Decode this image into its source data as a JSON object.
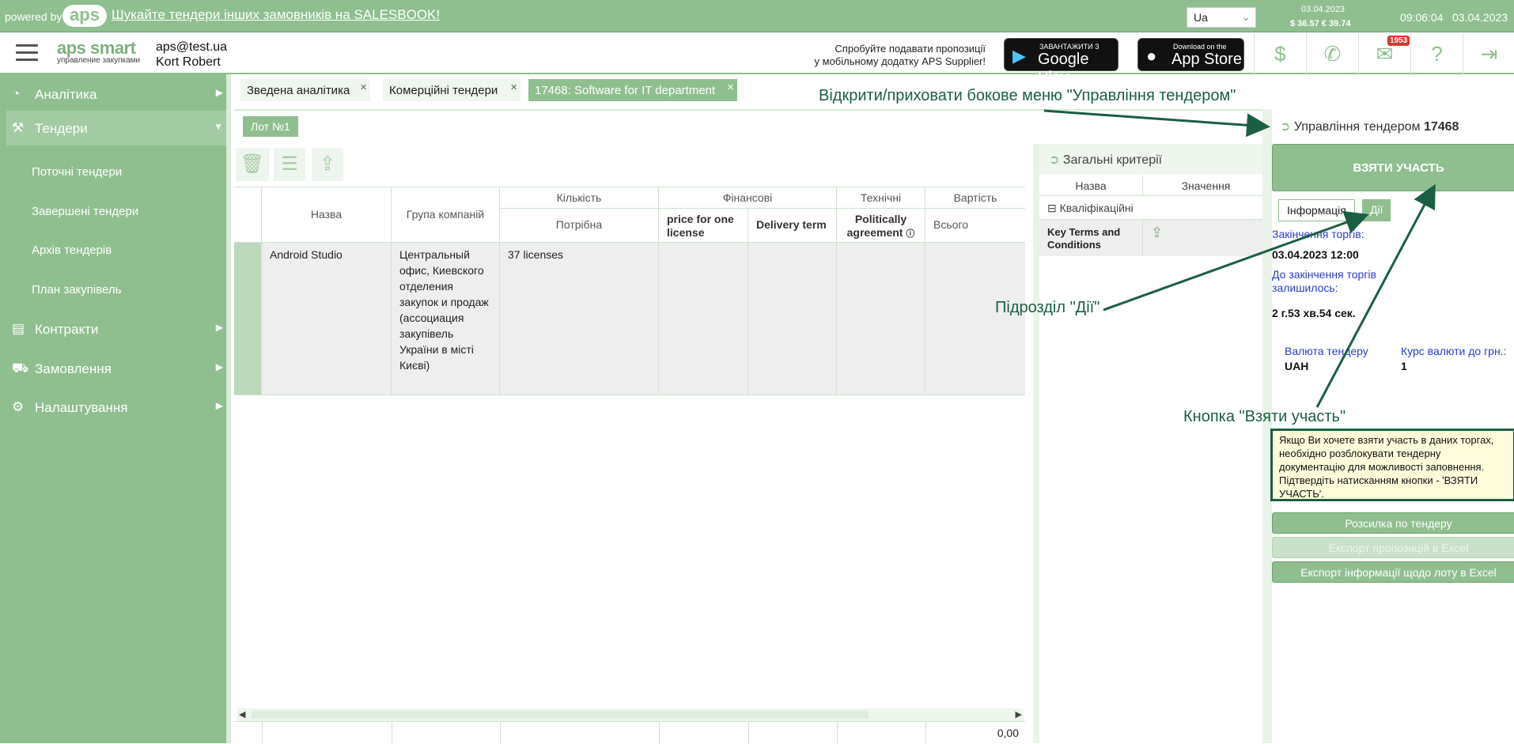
{
  "topbar": {
    "powered_by": "powered by",
    "logo_text": "aps",
    "promo_link": "Шукайте тендери інших замовників на SALESBOOK!",
    "language": "Ua",
    "rate_date": "03.04.2023",
    "rates": "$ 36.57  € 39.74",
    "time": "09:06:04",
    "date": "03.04.2023"
  },
  "header": {
    "logo_main": "aps smart",
    "logo_sub": "управление закупками",
    "user_email": "aps@test.ua",
    "user_name": "Kort Robert",
    "app_promo_line1": "Спробуйте подавати пропозиції",
    "app_promo_line2": "у мобільному додатку APS Supplier!",
    "google_small": "ЗАВАНТАЖИТИ З",
    "google_big": "Google Play",
    "apple_small": "Download on the",
    "apple_big": "App Store",
    "mail_badge": "1953"
  },
  "sidebar": {
    "items": [
      {
        "label": "Аналітика"
      },
      {
        "label": "Тендери"
      },
      {
        "label": "Контракти"
      },
      {
        "label": "Замовлення"
      },
      {
        "label": "Налаштування"
      }
    ],
    "sub_items": [
      {
        "label": "Поточні тендери"
      },
      {
        "label": "Завершені тендери"
      },
      {
        "label": "Архів тендерів"
      },
      {
        "label": "План закупівель"
      }
    ]
  },
  "tabs": [
    {
      "label": "Зведена аналітика"
    },
    {
      "label": "Комерційні тендери"
    },
    {
      "label": "17468: Software for IT department"
    }
  ],
  "lot": {
    "label": "Лот №1"
  },
  "table": {
    "headers": {
      "name": "Назва",
      "group": "Група компаній",
      "quantity": "Кількість",
      "financial": "Фінансові",
      "technical": "Технічні",
      "cost": "Вартість",
      "required": "Потрібна",
      "price": "price for one license",
      "delivery": "Delivery term",
      "political": "Politically agreement",
      "total": "Всього"
    },
    "rows": [
      {
        "name": "Android Studio",
        "group": "Центральный офис, Киевского отделения закупок и продаж (ассоциация закупівель України в місті Києві)",
        "required": "37 licenses"
      }
    ],
    "footer_total": "0,00"
  },
  "criteria": {
    "title": "Загальні критерії",
    "col_name": "Назва",
    "col_value": "Значення",
    "group": "Кваліфікаційні",
    "item": "Key Terms and Conditions"
  },
  "right_panel": {
    "title_prefix": "Управління тендером",
    "tender_id": "17468",
    "take_part": "ВЗЯТИ УЧАСТЬ",
    "tab_info": "Інформація",
    "tab_actions": "Дії",
    "end_label": "Закінчення торгів:",
    "end_value": "03.04.2023 12:00",
    "remaining_label": "До закінчення торгів залишилось:",
    "remaining_value": "2 г.53 хв.54 сек.",
    "currency_label": "Валюта тендеру",
    "currency_value": "UAH",
    "rate_label": "Курс валюти до грн.:",
    "rate_value": "1",
    "note": "Якщо Ви хочете взяти участь в даних торгах, необхідно розблокувати тендерну документацію для можливості заповнення. Підтвердіть натисканням кнопки - 'ВЗЯТИ УЧАСТЬ'.",
    "btn_mailing": "Розсилка по тендеру",
    "btn_export_offers": "Експорт пропозицій в Excel",
    "btn_export_lot": "Експорт інформації щодо лоту в Excel"
  },
  "annotations": {
    "side_menu": "Відкрити/приховати бокове меню \"Управління тендером\"",
    "actions_section": "Підрозділ \"Дії\"",
    "take_part_button": "Кнопка \"Взяти участь\""
  }
}
